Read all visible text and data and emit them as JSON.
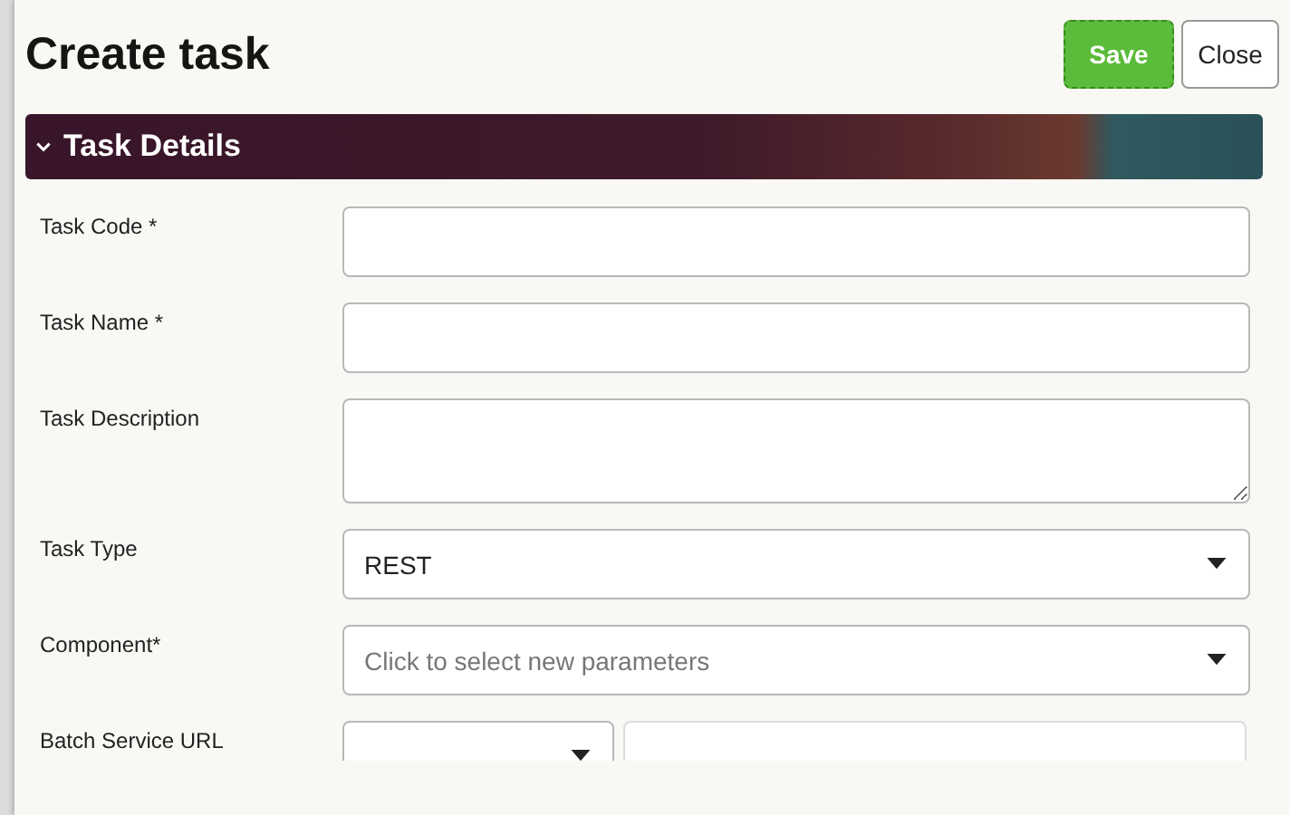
{
  "dialog": {
    "title": "Create task"
  },
  "buttons": [
    {
      "label": "Save",
      "kind": "primary"
    },
    {
      "label": "Close",
      "kind": "secondary"
    }
  ],
  "section": {
    "title": "Task Details",
    "expanded": true
  },
  "fields": [
    {
      "label": "Task Code *",
      "kind": "text"
    },
    {
      "label": "Task Name *",
      "kind": "text"
    },
    {
      "label": "Task Description",
      "kind": "textarea"
    },
    {
      "label": "Task Type",
      "kind": "select",
      "value": "REST"
    },
    {
      "label": "Component*",
      "kind": "select",
      "placeholder": "Click to select new parameters"
    },
    {
      "label": "Batch Service URL",
      "kind": "url"
    }
  ]
}
